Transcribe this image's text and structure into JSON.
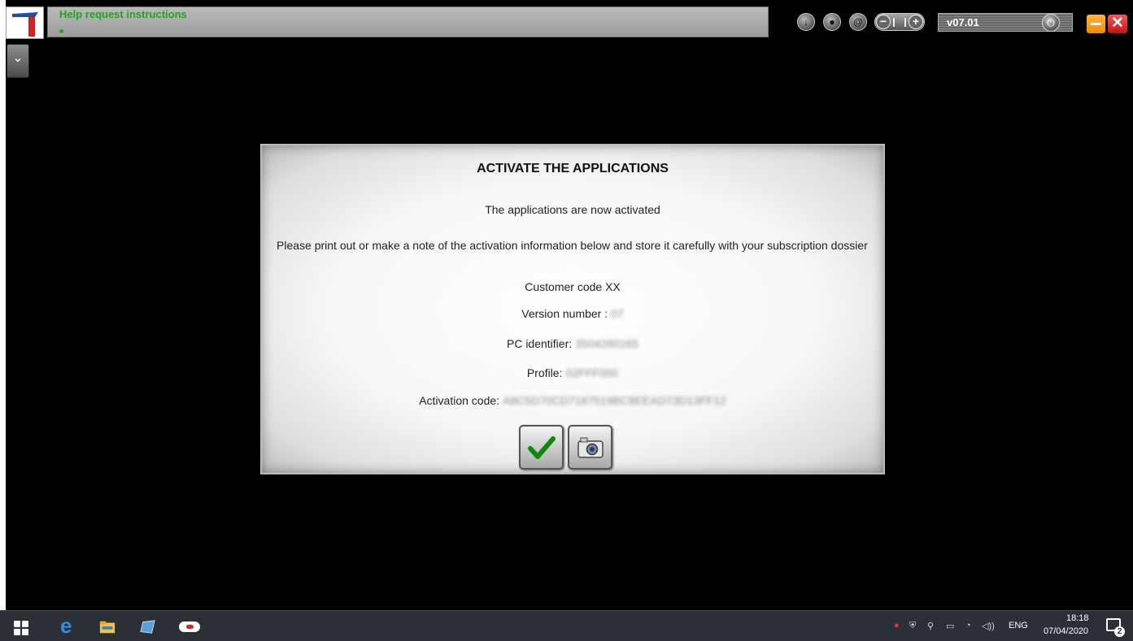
{
  "topbar": {
    "help_text": "Help request instructions",
    "version": "v07.01",
    "icons": [
      "download-icon",
      "user-icon",
      "at-icon",
      "zoom-control",
      "power-icon",
      "minimize-icon",
      "close-icon"
    ]
  },
  "dialog": {
    "title": "ACTIVATE THE APPLICATIONS",
    "status": "The applications are now activated",
    "instructions": "Please print out or make a note of the activation information below and store it carefully with your subscription dossier",
    "customer_code": "Customer code XX",
    "version_label": "Version number :",
    "version_value": "07",
    "pc_label": "PC identifier:",
    "pc_value": "3504280165",
    "profile_label": "Profile:",
    "profile_value": "02FFF000",
    "activation_label": "Activation code:",
    "activation_value": "A8C5D70CD7187519BC8EEAD73D13FF12"
  },
  "taskbar": {
    "language": "ENG",
    "time": "18:18",
    "date": "07/04/2020",
    "notifications": "2"
  },
  "colors": {
    "help_text": "#1aa81a",
    "minimize": "#f08a00",
    "close": "#c41212",
    "taskbar": "#2b2f36"
  }
}
